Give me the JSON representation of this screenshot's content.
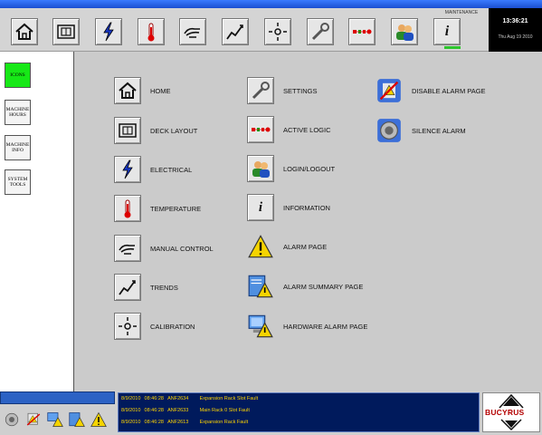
{
  "toolbar": {
    "buttons": [
      {
        "name": "home-icon"
      },
      {
        "name": "deck-layout-icon"
      },
      {
        "name": "electrical-icon"
      },
      {
        "name": "temperature-icon"
      },
      {
        "name": "manual-control-icon"
      },
      {
        "name": "trends-icon"
      },
      {
        "name": "calibration-icon"
      },
      {
        "name": "settings-icon"
      },
      {
        "name": "active-logic-icon"
      },
      {
        "name": "login-logout-icon"
      },
      {
        "name": "information-icon"
      }
    ],
    "maintenance_label": "MAINTENANCE",
    "info_glyph": "i"
  },
  "clock": {
    "time": "13:36:21",
    "date": "Thu Aug 19 2010"
  },
  "leftnav": {
    "items": [
      {
        "label": "ICONS",
        "active": true
      },
      {
        "label": "MACHINE HOURS",
        "active": false
      },
      {
        "label": "MACHINE INFO",
        "active": false
      },
      {
        "label": "SYSTEM TOOLS",
        "active": false
      }
    ]
  },
  "legend": {
    "col1": [
      {
        "icon": "home-icon",
        "label": "HOME"
      },
      {
        "icon": "deck-layout-icon",
        "label": "DECK LAYOUT"
      },
      {
        "icon": "electrical-icon",
        "label": "ELECTRICAL"
      },
      {
        "icon": "temperature-icon",
        "label": "TEMPERATURE"
      },
      {
        "icon": "manual-control-icon",
        "label": "MANUAL CONTROL"
      },
      {
        "icon": "trends-icon",
        "label": "TRENDS"
      },
      {
        "icon": "calibration-icon",
        "label": "CALIBRATION"
      }
    ],
    "col2": [
      {
        "icon": "settings-icon",
        "label": "SETTINGS"
      },
      {
        "icon": "active-logic-icon",
        "label": "ACTIVE LOGIC"
      },
      {
        "icon": "login-logout-icon",
        "label": "LOGIN/LOGOUT"
      },
      {
        "icon": "information-icon",
        "label": "INFORMATION"
      },
      {
        "icon": "alarm-page-icon",
        "label": "ALARM PAGE"
      },
      {
        "icon": "alarm-summary-icon",
        "label": "ALARM SUMMARY PAGE"
      },
      {
        "icon": "hardware-alarm-icon",
        "label": "HARDWARE ALARM PAGE"
      }
    ],
    "col3": [
      {
        "icon": "disable-alarm-icon",
        "label": "DISABLE ALARM PAGE"
      },
      {
        "icon": "silence-alarm-icon",
        "label": "SILENCE ALARM"
      }
    ]
  },
  "alarms": [
    {
      "date": "8/9/2010",
      "time": "08:46:28",
      "code": "ANF2634",
      "message": "Expansion Rack Slot Fault"
    },
    {
      "date": "8/9/2010",
      "time": "08:46:28",
      "code": "ANF2633",
      "message": "Main Rack 0 Slot Fault"
    },
    {
      "date": "8/9/2010",
      "time": "08:46:28",
      "code": "ANF2613",
      "message": "Expansion Rack Fault"
    }
  ],
  "bottom_icons": [
    "silence-alarm-icon",
    "disable-alarm-icon",
    "hardware-alarm-icon",
    "alarm-summary-icon",
    "alarm-page-icon"
  ],
  "logo": {
    "text": "BUCYRUS"
  },
  "colors": {
    "active_nav": "#17e817",
    "alarm_text": "#ffd400",
    "alarm_bg": "#001a5c",
    "title_bar": "#1a4fd0"
  }
}
